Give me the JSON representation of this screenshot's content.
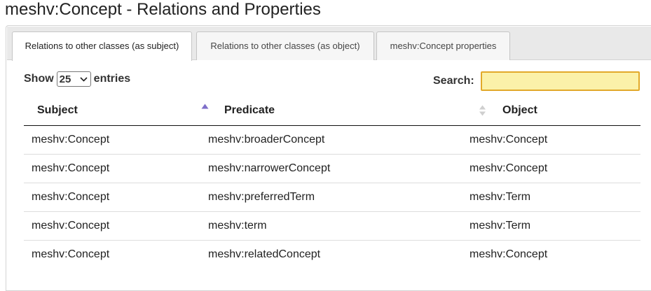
{
  "page": {
    "title": "meshv:Concept - Relations and Properties"
  },
  "tabs": [
    {
      "label": "Relations to other classes (as subject)",
      "active": true
    },
    {
      "label": "Relations to other classes (as object)",
      "active": false
    },
    {
      "label": "meshv:Concept properties",
      "active": false
    }
  ],
  "length_control": {
    "show_label": "Show",
    "selected": "25",
    "entries_label": "entries",
    "icon": "chevron-down-icon"
  },
  "search": {
    "label": "Search:",
    "value": "",
    "placeholder": ""
  },
  "table": {
    "columns": [
      {
        "label": "Subject",
        "sort": "none"
      },
      {
        "label": "Predicate",
        "sort": "ascending",
        "sort_icon": "sort-asc-icon"
      },
      {
        "label": "Object",
        "sort": "both",
        "sort_icon": "sort-both-icon"
      }
    ],
    "rows": [
      {
        "subject": "meshv:Concept",
        "predicate": "meshv:broaderConcept",
        "object": "meshv:Concept"
      },
      {
        "subject": "meshv:Concept",
        "predicate": "meshv:narrowerConcept",
        "object": "meshv:Concept"
      },
      {
        "subject": "meshv:Concept",
        "predicate": "meshv:preferredTerm",
        "object": "meshv:Term"
      },
      {
        "subject": "meshv:Concept",
        "predicate": "meshv:term",
        "object": "meshv:Term"
      },
      {
        "subject": "meshv:Concept",
        "predicate": "meshv:relatedConcept",
        "object": "meshv:Concept"
      }
    ]
  },
  "colors": {
    "search_bg": "#fbf1a9",
    "search_border": "#e2a92a",
    "sort_active": "#7e6ec9",
    "sort_inactive": "#cfcfcf"
  }
}
